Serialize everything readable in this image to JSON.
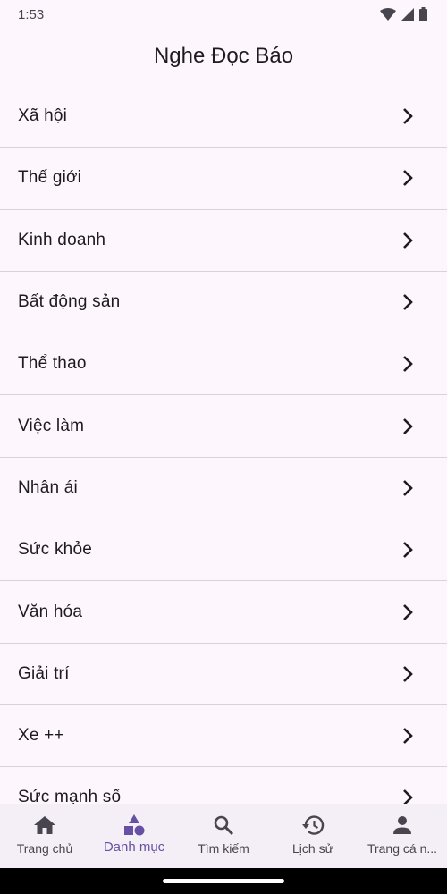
{
  "status_bar": {
    "time": "1:53",
    "icons": [
      "wifi-icon",
      "signal-icon",
      "battery-icon"
    ]
  },
  "app_bar": {
    "title": "Nghe Đọc Báo"
  },
  "categories": [
    {
      "label": "Xã hội"
    },
    {
      "label": "Thế giới"
    },
    {
      "label": "Kinh doanh"
    },
    {
      "label": "Bất động sản"
    },
    {
      "label": "Thể thao"
    },
    {
      "label": "Việc làm"
    },
    {
      "label": "Nhân ái"
    },
    {
      "label": "Sức khỏe"
    },
    {
      "label": "Văn hóa"
    },
    {
      "label": "Giải trí"
    },
    {
      "label": "Xe ++"
    },
    {
      "label": "Sức mạnh số"
    }
  ],
  "bottom_nav": {
    "items": [
      {
        "label": "Trang chủ",
        "icon": "home-icon"
      },
      {
        "label": "Danh mục",
        "icon": "category-icon",
        "active": true
      },
      {
        "label": "Tìm kiếm",
        "icon": "search-icon"
      },
      {
        "label": "Lịch sử",
        "icon": "history-icon"
      },
      {
        "label": "Trang cá n...",
        "icon": "person-icon"
      }
    ]
  },
  "colors": {
    "background": "#fdf7fd",
    "accent": "#6750a4",
    "nav_background": "#f4eef6",
    "divider": "#d8d3da"
  }
}
